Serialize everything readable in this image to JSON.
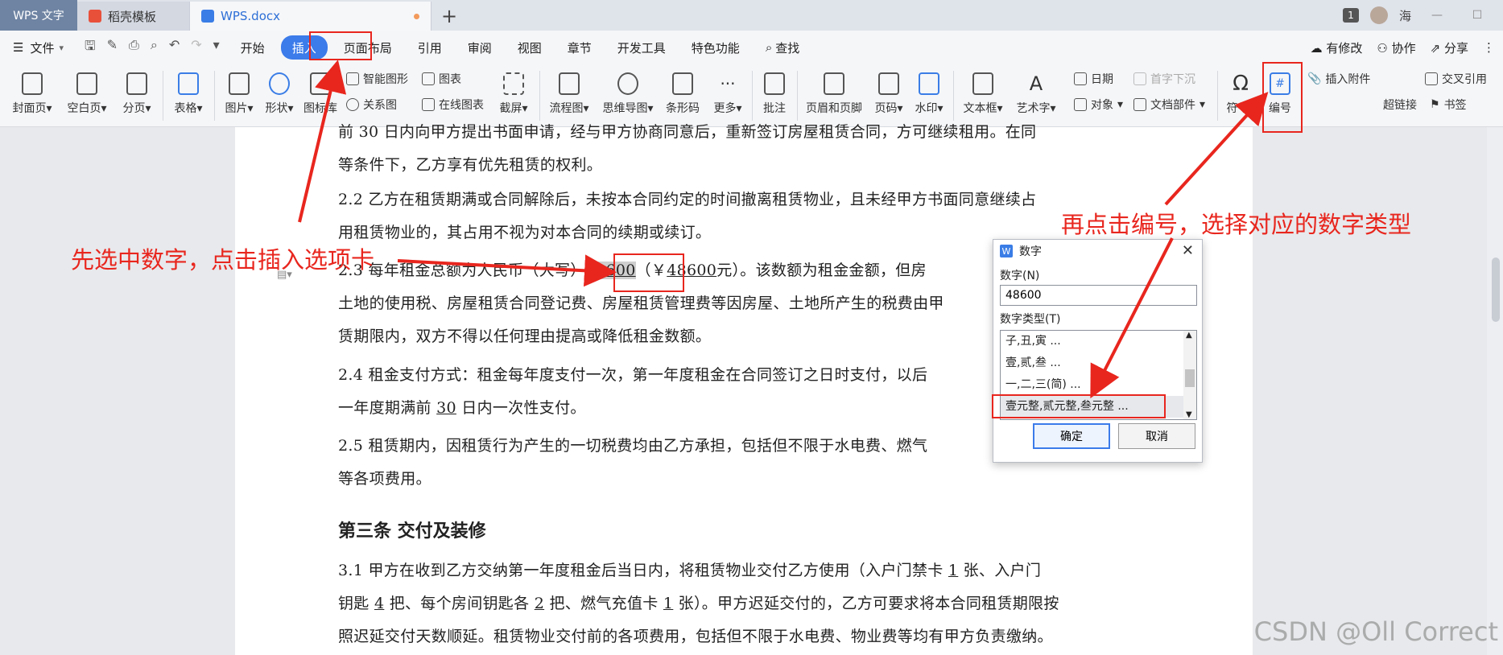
{
  "titlebar": {
    "app_tab": "WPS 文字",
    "tabs": [
      {
        "label": "稻壳模板"
      },
      {
        "label": "WPS.docx"
      }
    ],
    "new_tab": "+",
    "window_count": "1",
    "user_name": "海",
    "minimize": "—"
  },
  "menubar": {
    "file": "文件",
    "items": [
      "开始",
      "插入",
      "页面布局",
      "引用",
      "审阅",
      "视图",
      "章节",
      "开发工具",
      "特色功能",
      "查找"
    ],
    "active": "插入",
    "right": [
      "有修改",
      "协作",
      "分享"
    ]
  },
  "ribbon": {
    "big": [
      "封面页",
      "空白页",
      "分页",
      "表格",
      "图片",
      "形状",
      "图标库",
      "截屏",
      "流程图",
      "思维导图",
      "条形码",
      "更多",
      "批注",
      "页眉和页脚",
      "页码",
      "水印",
      "文本框",
      "艺术字",
      "符号",
      "编号"
    ],
    "small": [
      "智能图形",
      "图表",
      "关系图",
      "在线图表",
      "日期",
      "首字下沉",
      "对象",
      "文档部件",
      "插入附件",
      "交叉引用",
      "超链接",
      "书签"
    ]
  },
  "document": {
    "p1_tail": "前 30 日内向甲方提出书面申请，经与甲方协商同意后，重新签订房屋租赁合同，方可继续租用。在同",
    "p1_line2": "等条件下，乙方享有优先租赁的权利。",
    "p2_line1": "2.2  乙方在租赁期满或合同解除后，未按本合同约定的时间撤离租赁物业，且未经甲方书面同意继续占",
    "p2_line2": "用租赁物业的，其占用不视为对本合同的续期或续订。",
    "p3_prefix": "2.3  每年租金总额为人民币（大写）",
    "p3_selected": "48600",
    "p3_mid": "（￥",
    "p3_amount": "48600",
    "p3_suffix": "元）。该数额为租金金额，但房",
    "p3_line2": "土地的使用税、房屋租赁合同登记费、房屋租赁管理费等因房屋、土地所产生的税费由甲",
    "p3_line3": "赁期限内，双方不得以任何理由提高或降低租金数额。",
    "p4_line1": "2.4  租金支付方式：租金每年度支付一次，第一年度租金在合同签订之日时支付，以后",
    "p4_line2_a": "一年度期满前",
    "p4_line2_num": "30",
    "p4_line2_b": "日内一次性支付。",
    "p5_line1": "2.5  租赁期内，因租赁行为产生的一切税费均由乙方承担，包括但不限于水电费、燃气",
    "p5_line2": "等各项费用。",
    "heading3": "第三条  交付及装修",
    "p6_line1_a": "3.1  甲方在收到乙方交纳第一年度租金后当日内，将租赁物业交付乙方使用（入户门禁卡",
    "p6_n1": "1",
    "p6_line1_b": "张、入户门",
    "p6_line2_a": "钥匙",
    "p6_n2": "4",
    "p6_line2_b": "把、每个房间钥匙各",
    "p6_n3": "2",
    "p6_line2_c": "把、燃气充值卡",
    "p6_n4": "1",
    "p6_line2_d": "张）。甲方迟延交付的，乙方可要求将本合同租赁期限按",
    "p6_line3": "照迟延交付天数顺延。租赁物业交付前的各项费用，包括但不限于水电费、物业费等均有甲方负责缴纳。"
  },
  "dialog": {
    "title": "数字",
    "number_label": "数字(N)",
    "number_value": "48600",
    "type_label": "数字类型(T)",
    "types": [
      "子,丑,寅 ...",
      "壹,贰,叁 ...",
      "一,二,三(简) ...",
      "壹元整,贰元整,叁元整 ..."
    ],
    "selected_index": 3,
    "ok": "确定",
    "cancel": "取消",
    "close": "✕"
  },
  "annotations": {
    "left": "先选中数字，点击插入选项卡",
    "right": "再点击编号，选择对应的数字类型",
    "color": "#e8261e"
  },
  "watermark": "CSDN @Oll Correct"
}
